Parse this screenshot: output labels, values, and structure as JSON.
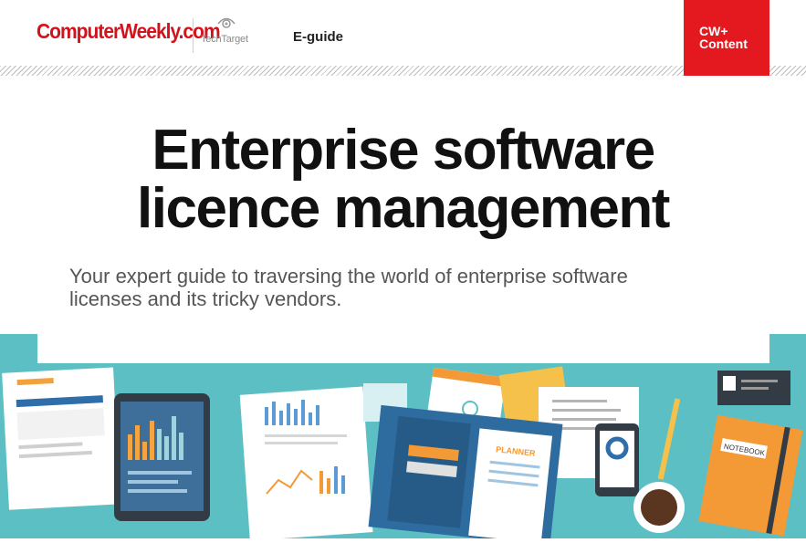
{
  "header": {
    "logo_text": "ComputerWeekly.com",
    "partner_text": "TechTarget",
    "doc_type": "E-guide",
    "badge_line1": "CW+",
    "badge_line2": "Content"
  },
  "main": {
    "title_line1": "Enterprise software",
    "title_line2": "licence management",
    "subtitle_line1": "Your expert guide to traversing the world of enterprise software",
    "subtitle_line2": "licenses and its tricky vendors."
  },
  "illustration": {
    "planner_label": "PLANNER",
    "notebook_label": "NOTEBOOK",
    "background_color": "#5cbfc4",
    "accent_color": "#e4181f"
  }
}
